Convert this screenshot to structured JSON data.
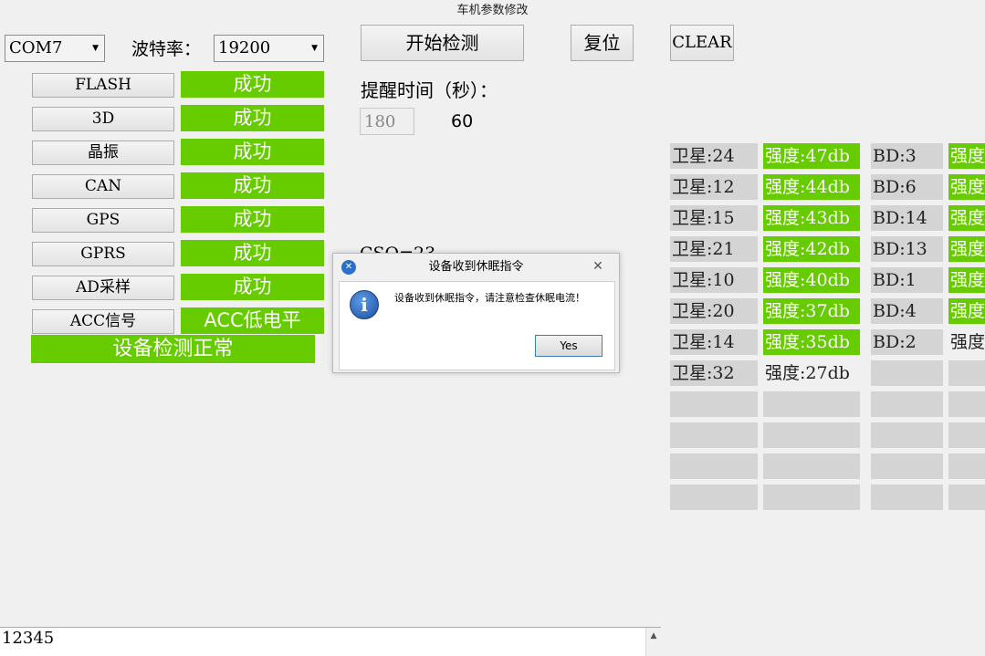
{
  "window": {
    "title": "车机参数修改"
  },
  "toolbar": {
    "port": "COM7",
    "baud_label": "波特率：",
    "baud": "19200",
    "start_label": "开始检测",
    "reset_label": "复位",
    "clear_label": "CLEAR"
  },
  "tests": [
    {
      "label": "FLASH",
      "result": "成功"
    },
    {
      "label": "3D",
      "result": "成功"
    },
    {
      "label": "晶振",
      "result": "成功"
    },
    {
      "label": "CAN",
      "result": "成功"
    },
    {
      "label": "GPS",
      "result": "成功"
    },
    {
      "label": "GPRS",
      "result": "成功"
    },
    {
      "label": "AD采样",
      "result": "成功"
    },
    {
      "label": "ACC信号",
      "result": "ACC低电平"
    }
  ],
  "overall_status": "设备检测正常",
  "reminder": {
    "label": "提醒时间（秒）：",
    "input_value": "180",
    "current": "60"
  },
  "partial_label": "CSQ=23",
  "satellites": [
    {
      "sat": "卫星:24",
      "strength": "强度:47db",
      "bd": "BD:3",
      "bd_strength": "强度"
    },
    {
      "sat": "卫星:12",
      "strength": "强度:44db",
      "bd": "BD:6",
      "bd_strength": "强度"
    },
    {
      "sat": "卫星:15",
      "strength": "强度:43db",
      "bd": "BD:14",
      "bd_strength": "强度"
    },
    {
      "sat": "卫星:21",
      "strength": "强度:42db",
      "bd": "BD:13",
      "bd_strength": "强度"
    },
    {
      "sat": "卫星:10",
      "strength": "强度:40db",
      "bd": "BD:1",
      "bd_strength": "强度"
    },
    {
      "sat": "卫星:20",
      "strength": "强度:37db",
      "bd": "BD:4",
      "bd_strength": "强度"
    },
    {
      "sat": "卫星:14",
      "strength": "强度:35db",
      "bd": "BD:2",
      "bd_strength": "强度"
    },
    {
      "sat": "卫星:32",
      "strength": "强度:27db",
      "bd": "",
      "bd_strength": ""
    }
  ],
  "dialog": {
    "title": "设备收到休眠指令",
    "message": "设备收到休眠指令，请注意检查休眠电流！",
    "yes_label": "Yes"
  },
  "log": {
    "line1": "12345"
  },
  "colors": {
    "success": "#66cc00",
    "cell_gray": "#d4d4d4",
    "background": "#f0f0f0"
  }
}
